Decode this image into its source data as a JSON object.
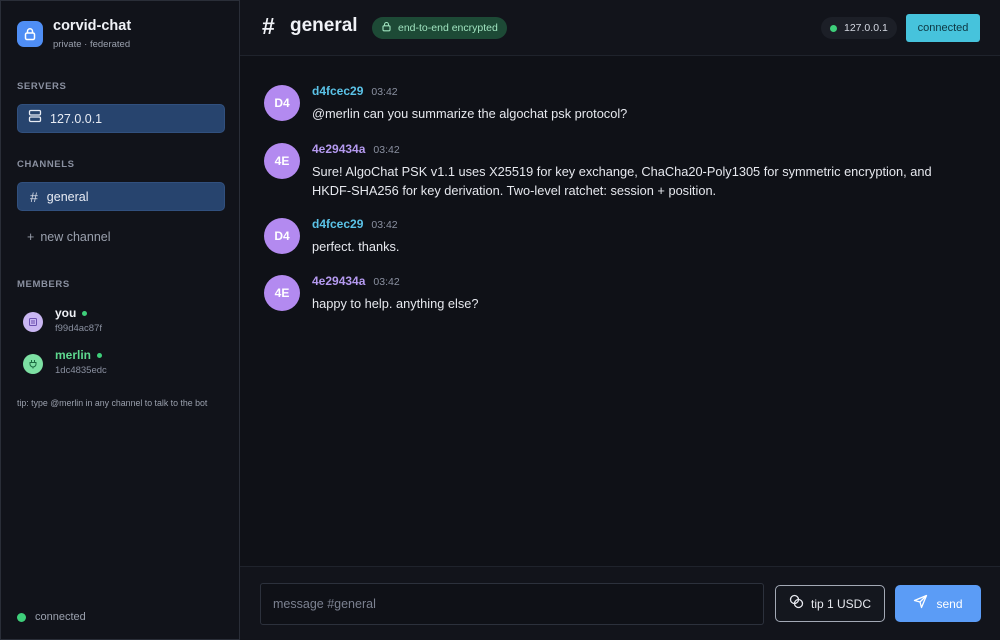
{
  "app": {
    "name": "corvid-chat",
    "subtitle": "private · federated"
  },
  "sidebar": {
    "servers_label": "SERVERS",
    "servers": [
      {
        "label": "127.0.0.1",
        "icon": "server-icon",
        "active": true
      }
    ],
    "channels_label": "CHANNELS",
    "channels": [
      {
        "label": "general",
        "icon": "hash-icon",
        "active": true
      }
    ],
    "new_channel_label": "new channel",
    "members_label": "MEMBERS",
    "members": [
      {
        "name": "you",
        "id": "f99d4ac87f",
        "color": "#c9b6f2",
        "avatar_bg": "#c9b6f2",
        "online": true
      },
      {
        "name": "merlin",
        "id": "1dc4835edc",
        "color": "#5ed98f",
        "avatar_bg": "#7de0a3",
        "online": true
      }
    ],
    "tip_note": "tip: type @merlin in any channel to talk to the bot",
    "status": "connected"
  },
  "header": {
    "channel_hash": "#",
    "channel_name": "general",
    "encryption_badge": "end-to-end encrypted",
    "host": "127.0.0.1",
    "connection_status": "connected"
  },
  "messages": [
    {
      "avatar": "D4",
      "author": "d4fcec29",
      "time": "03:42",
      "text": "@merlin can you summarize the algochat psk protocol?"
    },
    {
      "avatar": "4E",
      "author": "4e29434a",
      "time": "03:42",
      "text": "Sure! AlgoChat PSK v1.1 uses X25519 for key exchange, ChaCha20-Poly1305 for symmetric encryption, and HKDF-SHA256 for key derivation. Two-level ratchet: session + position."
    },
    {
      "avatar": "D4",
      "author": "d4fcec29",
      "time": "03:42",
      "text": "perfect. thanks."
    },
    {
      "avatar": "4E",
      "author": "4e29434a",
      "time": "03:42",
      "text": "happy to help. anything else?"
    }
  ],
  "composer": {
    "placeholder": "message #general",
    "value": "",
    "tip_label": "tip 1 USDC",
    "send_label": "send"
  },
  "colors": {
    "accent": "#5b9cf6",
    "online": "#3ecf7a",
    "connected_badge": "#46c3dc",
    "encrypted_badge": "#1d4a36"
  }
}
